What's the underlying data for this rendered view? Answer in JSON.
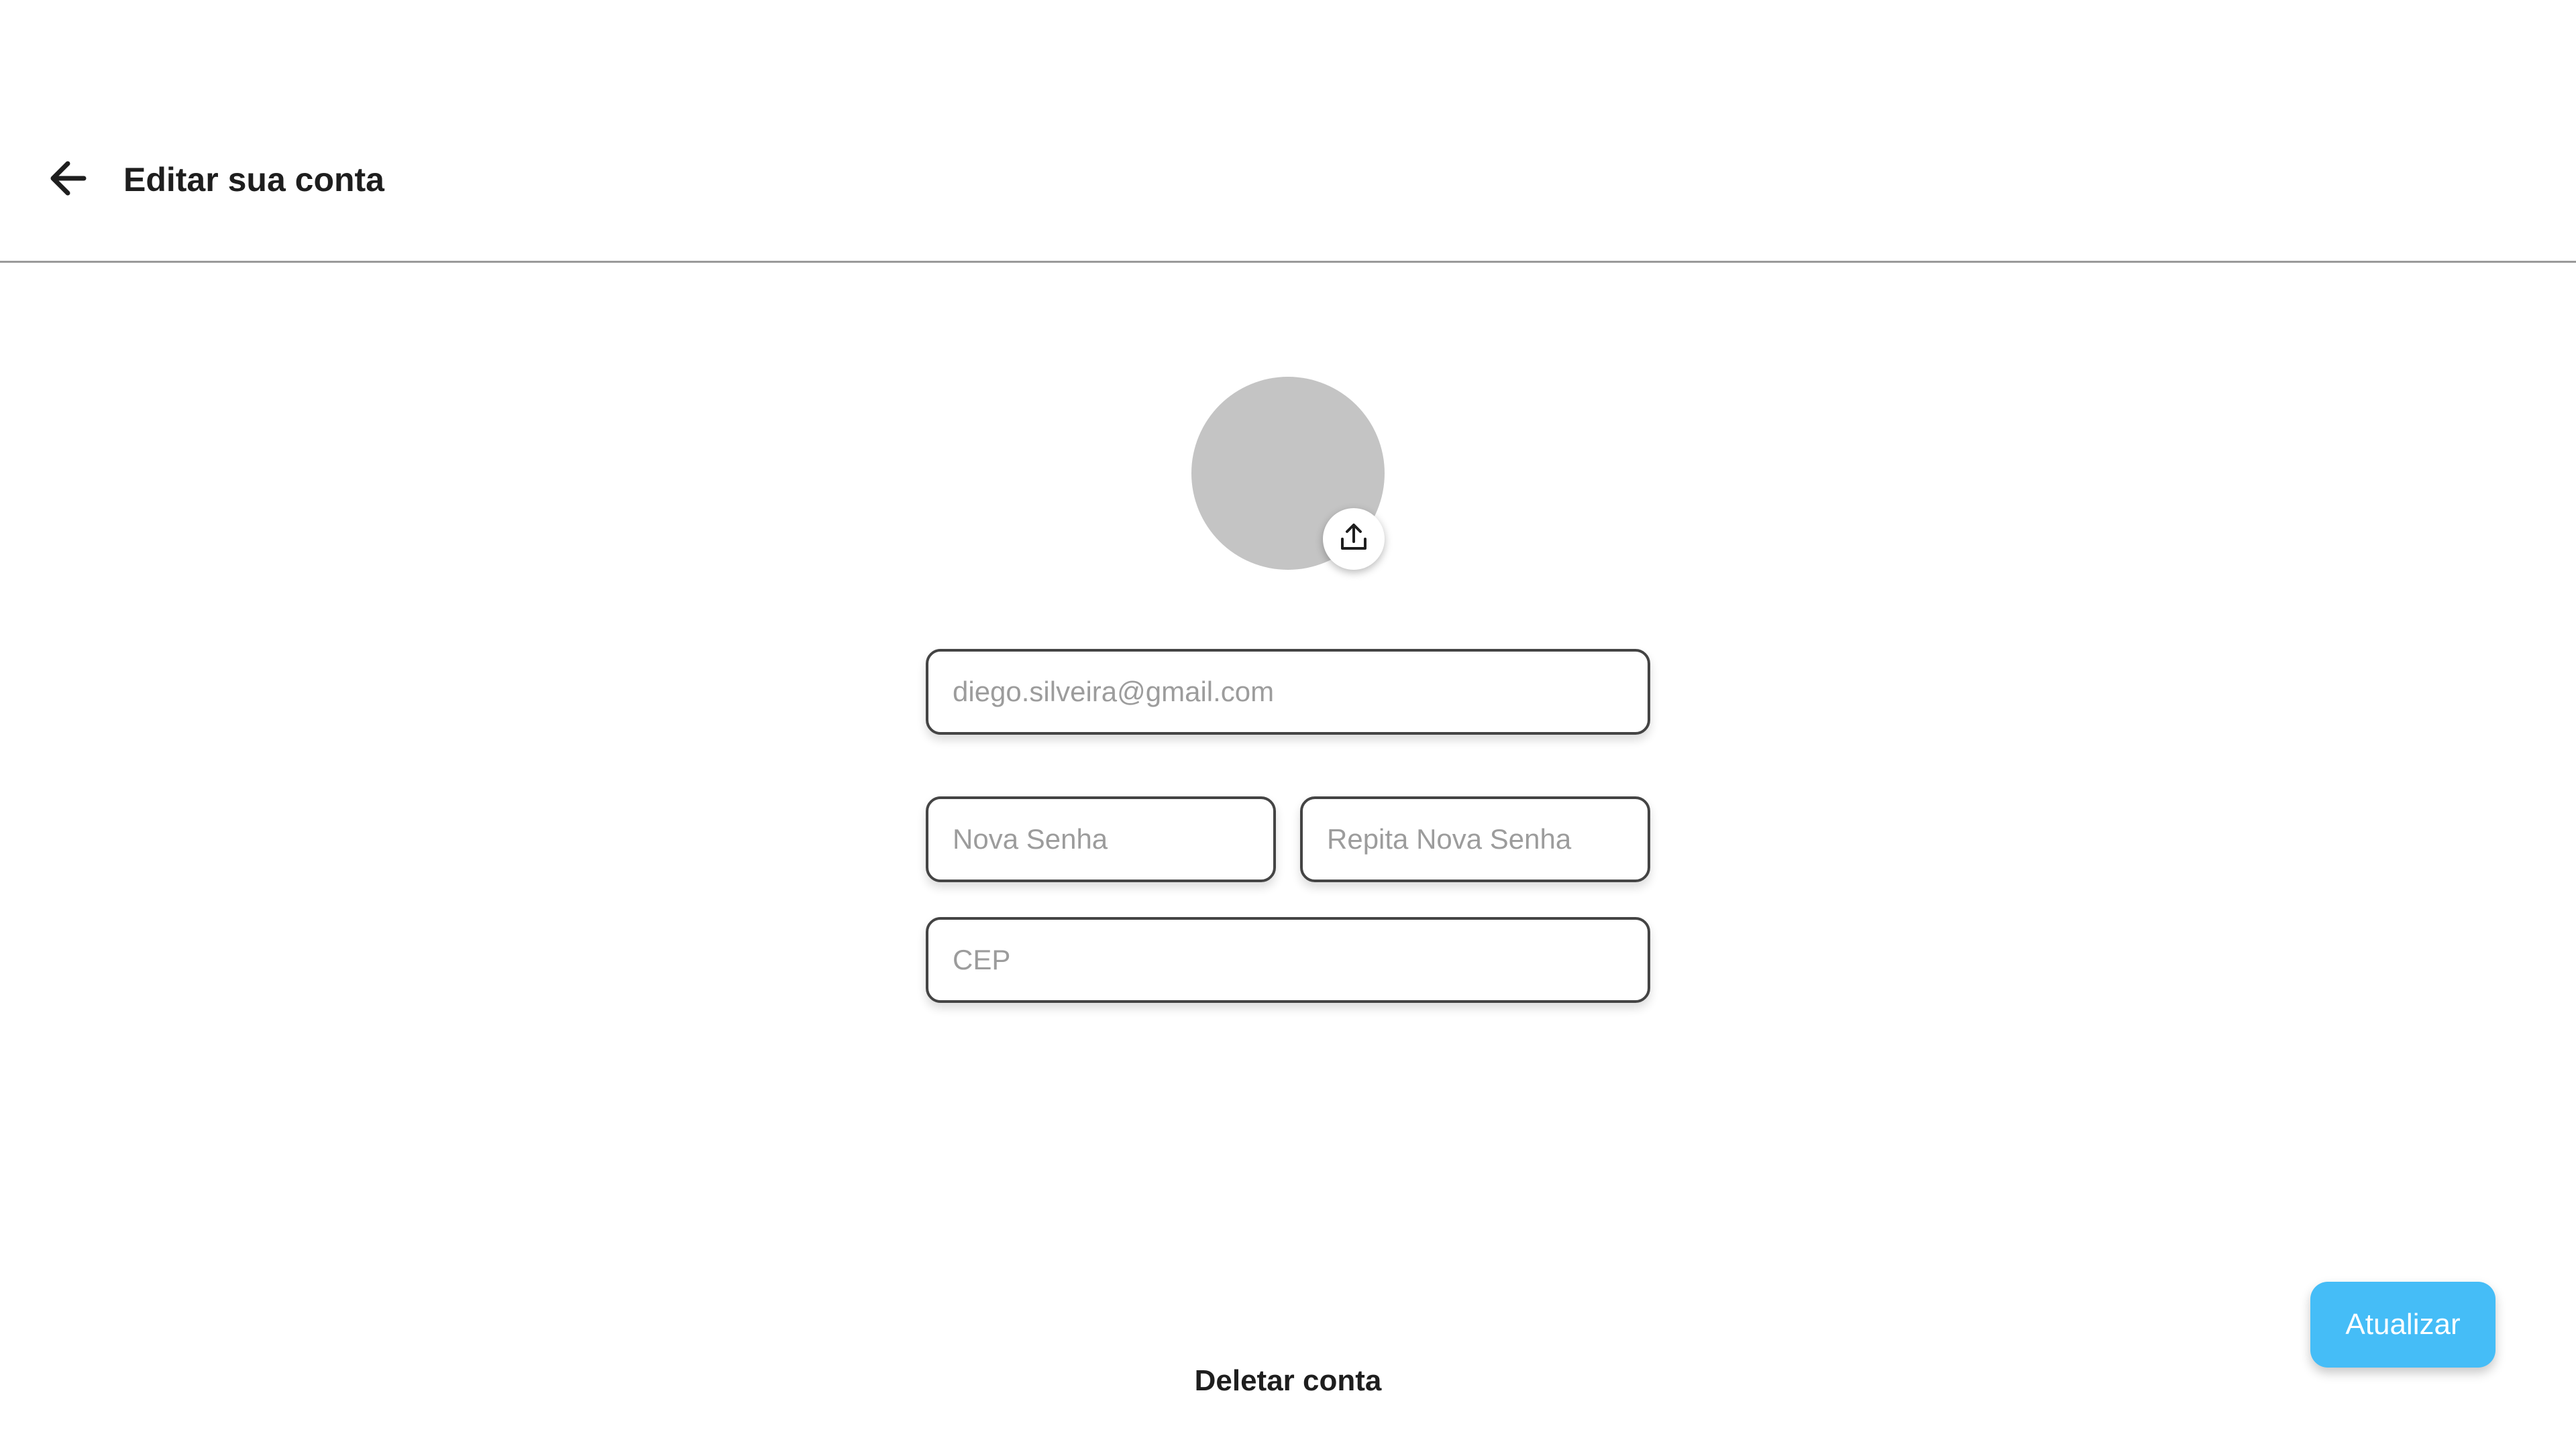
{
  "header": {
    "title": "Editar sua conta",
    "back_icon": "arrow-left-icon"
  },
  "avatar": {
    "placeholder_color": "#c4c4c4",
    "upload_icon": "upload-icon"
  },
  "form": {
    "email": {
      "placeholder": "diego.silveira@gmail.com",
      "value": ""
    },
    "new_password": {
      "placeholder": "Nova Senha",
      "value": ""
    },
    "repeat_password": {
      "placeholder": "Repita Nova Senha",
      "value": ""
    },
    "cep": {
      "placeholder": "CEP",
      "value": ""
    }
  },
  "actions": {
    "update_label": "Atualizar",
    "update_color": "#45bdf7",
    "delete_label": "Deletar conta"
  }
}
